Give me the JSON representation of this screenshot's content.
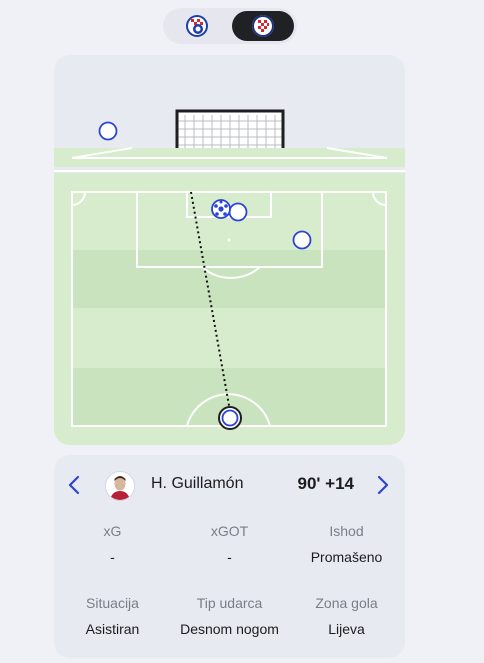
{
  "team_toggle": {
    "home_team_icon": "dinamo-zagreb-crest-icon",
    "away_team_icon": "hajduk-split-crest-icon",
    "selected": "away"
  },
  "pitch": {
    "shot_marker_icon": "football-icon",
    "shot_result": "missed",
    "shot_path_style": "dotted"
  },
  "shot_info": {
    "player_name": "H. Guillamón",
    "time": "90' +14",
    "prev_icon": "chevron-left-icon",
    "next_icon": "chevron-right-icon",
    "stats": [
      {
        "label": "xG",
        "value": "-"
      },
      {
        "label": "xGOT",
        "value": "-"
      },
      {
        "label": "Ishod",
        "value": "Promašeno"
      },
      {
        "label": "Situacija",
        "value": "Asistiran"
      },
      {
        "label": "Tip udarca",
        "value": "Desnom nogom"
      },
      {
        "label": "Zona gola",
        "value": "Lijeva"
      }
    ]
  },
  "colors": {
    "accent": "#2b44d6",
    "pitch_light": "#d6eccc",
    "pitch_dark": "#c7e2bc",
    "background": "#f0f1f6",
    "card": "#e8eaf2"
  }
}
